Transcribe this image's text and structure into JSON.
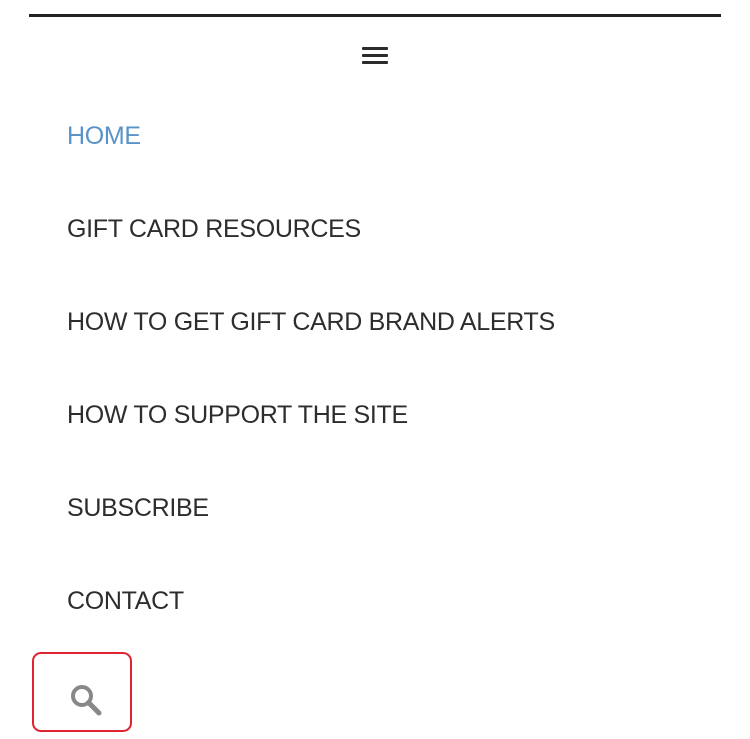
{
  "header": {
    "menu_icon": "hamburger-icon"
  },
  "menu": {
    "items": [
      {
        "label": "HOME",
        "active": true
      },
      {
        "label": "GIFT CARD RESOURCES",
        "active": false
      },
      {
        "label": "HOW TO GET GIFT CARD BRAND ALERTS",
        "active": false
      },
      {
        "label": "HOW TO SUPPORT THE SITE",
        "active": false
      },
      {
        "label": "SUBSCRIBE",
        "active": false
      },
      {
        "label": "CONTACT",
        "active": false
      }
    ]
  },
  "search": {
    "icon": "search-icon"
  },
  "colors": {
    "active_link": "#5b93c9",
    "text": "#2d2d2d",
    "highlight_border": "#e0232f",
    "icon": "#888888"
  }
}
